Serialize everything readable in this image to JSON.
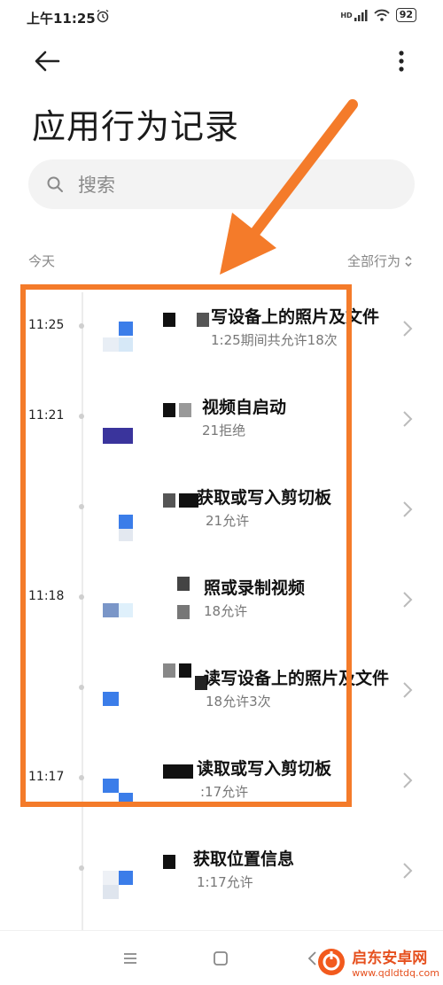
{
  "status_bar": {
    "time": "上午11:25",
    "network": "HD",
    "battery": "92"
  },
  "header": {
    "title": "应用行为记录"
  },
  "search": {
    "placeholder": "搜索"
  },
  "section": {
    "date": "今天",
    "filter": "全部行为"
  },
  "records": [
    {
      "time": "11:25",
      "title": "写设备上的照片及文件",
      "subtitle": "1:25期间共允许18次"
    },
    {
      "time": "11:21",
      "title": "视频自启动",
      "subtitle": "21拒绝"
    },
    {
      "time": "",
      "title": "获取或写入剪切板",
      "subtitle": "21允许"
    },
    {
      "time": "11:18",
      "title": "照或录制视频",
      "subtitle": "18允许"
    },
    {
      "time": "",
      "title": "读写设备上的照片及文件",
      "subtitle": "18允许3次"
    },
    {
      "time": "11:17",
      "title": "读取或写入剪切板",
      "subtitle": ":17允许"
    },
    {
      "time": "",
      "title": "获取位置信息",
      "subtitle": "1:17允许"
    }
  ],
  "watermark": {
    "name": "启东安卓网",
    "url": "www.qdldtdq.com"
  },
  "colors": {
    "highlight": "#f47b2a",
    "accent_blue": "#3b7de9"
  }
}
